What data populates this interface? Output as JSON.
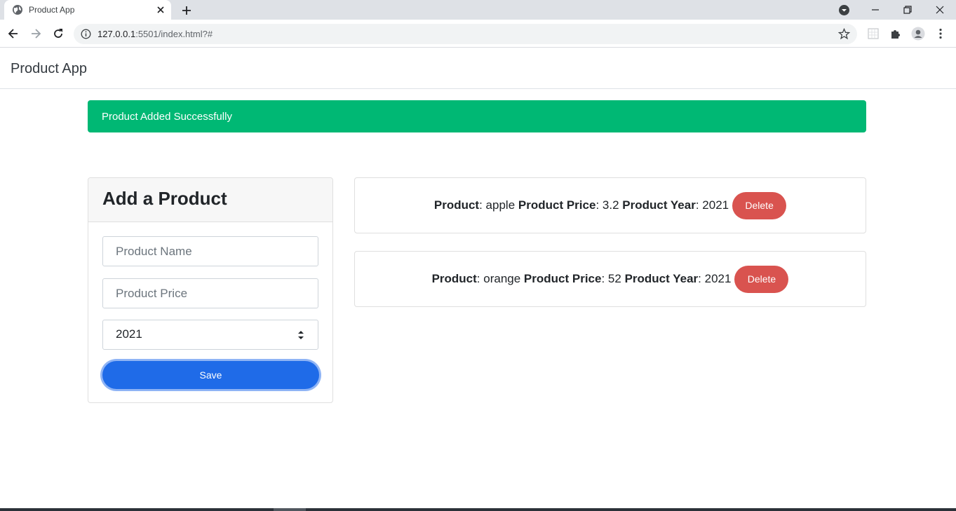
{
  "browser": {
    "tab_title": "Product App",
    "url_host": "127.0.0.1",
    "url_rest": ":5501/index.html?#"
  },
  "navbar": {
    "brand": "Product App"
  },
  "alert": {
    "message": "Product Added Successfully"
  },
  "form": {
    "title": "Add a Product",
    "name_placeholder": "Product Name",
    "price_placeholder": "Product Price",
    "year_value": "2021",
    "save_label": "Save"
  },
  "products": [
    {
      "label_product": "Product",
      "name": "apple",
      "label_price": "Product Price",
      "price": "3.2",
      "label_year": "Product Year",
      "year": "2021",
      "delete_label": "Delete"
    },
    {
      "label_product": "Product",
      "name": "orange",
      "label_price": "Product Price",
      "price": "52",
      "label_year": "Product Year",
      "year": "2021",
      "delete_label": "Delete"
    }
  ],
  "colors": {
    "alert_bg": "#00b874",
    "save_bg": "#1f6be8",
    "delete_bg": "#d9534f"
  }
}
